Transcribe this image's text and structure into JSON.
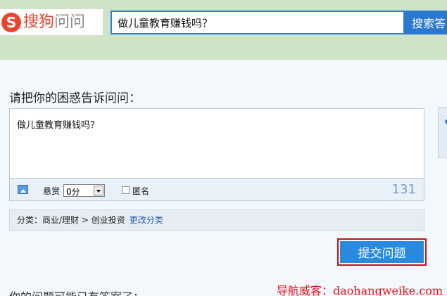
{
  "header": {
    "logo_mark": "S",
    "logo_text_brand": "搜狗",
    "logo_text_product": "问问",
    "search_value": "做儿童教育赚钱吗？",
    "search_button": "搜索答"
  },
  "ask": {
    "title": "请把你的困惑告诉问问：",
    "question": "做儿童教育赚钱吗？"
  },
  "toolbar": {
    "image_icon": "image-icon",
    "reward_label": "悬赏",
    "reward_value": "0分",
    "anonymous_label": "匿名",
    "anonymous_checked": false,
    "char_count": "131"
  },
  "category": {
    "text": "分类：商业/理财 > 创业投资",
    "change_link": "更改分类"
  },
  "submit_button": "提交问题",
  "bottom_hint": "你的问题可能已有答案了：",
  "watermark": "导航威客：daohangweike.com",
  "colors": {
    "brand_red": "#e8442e",
    "search_blue": "#2a78cf",
    "submit_blue": "#2a8ade",
    "highlight_red": "#c9101a",
    "link_blue": "#2a62b5"
  }
}
